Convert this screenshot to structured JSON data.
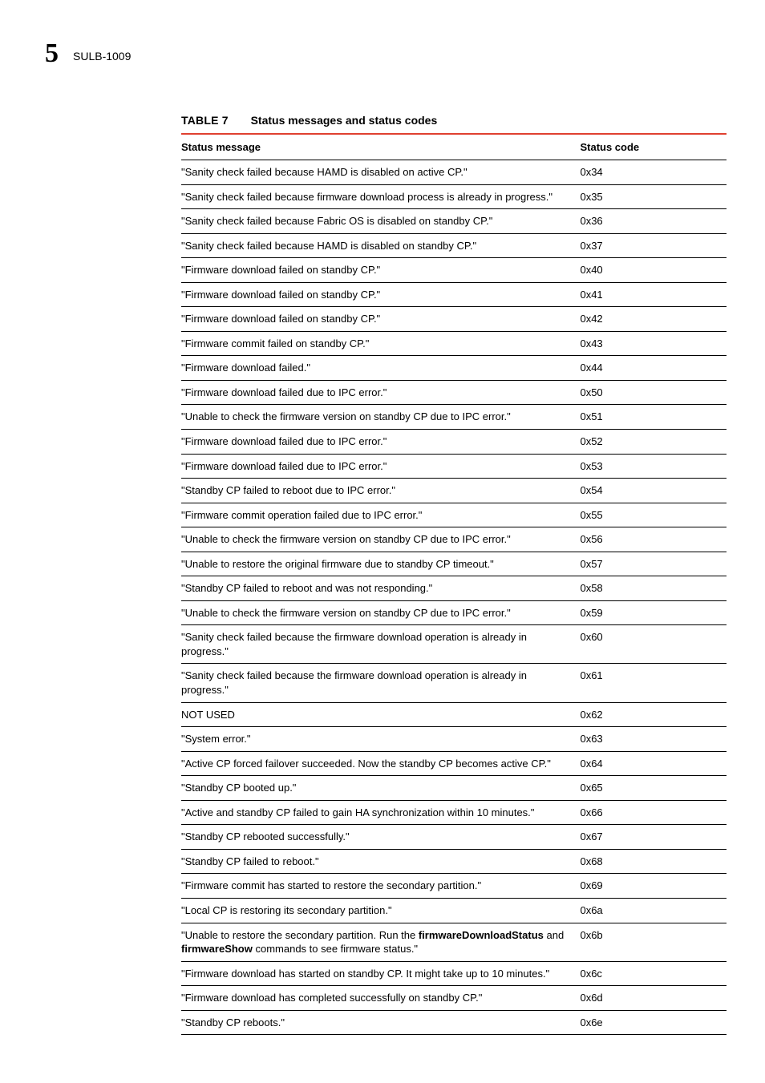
{
  "header": {
    "chapter_number": "5",
    "code": "SULB-1009"
  },
  "table": {
    "label": "TABLE 7",
    "title": "Status messages and status codes",
    "columns": {
      "message": "Status message",
      "code": "Status code"
    },
    "rows": [
      {
        "message": "\"Sanity check failed because HAMD is disabled on active CP.\"",
        "code": "0x34"
      },
      {
        "message": "\"Sanity check failed because firmware download process is already in progress.\"",
        "code": "0x35"
      },
      {
        "message": "\"Sanity check failed because Fabric OS is disabled on standby CP.\"",
        "code": "0x36"
      },
      {
        "message": "\"Sanity check failed because HAMD is disabled on standby CP.\"",
        "code": "0x37"
      },
      {
        "message": "\"Firmware download failed on standby CP.\"",
        "code": "0x40"
      },
      {
        "message": "\"Firmware download failed on standby CP.\"",
        "code": "0x41"
      },
      {
        "message": "\"Firmware download failed on standby CP.\"",
        "code": "0x42"
      },
      {
        "message": "\"Firmware commit failed on standby CP.\"",
        "code": "0x43"
      },
      {
        "message": "\"Firmware download failed.\"",
        "code": "0x44"
      },
      {
        "message": "\"Firmware download failed due to IPC error.\"",
        "code": "0x50"
      },
      {
        "message": "\"Unable to check the firmware version on standby CP due to IPC error.\"",
        "code": "0x51"
      },
      {
        "message": "\"Firmware download failed due to IPC error.\"",
        "code": "0x52"
      },
      {
        "message": "\"Firmware download failed due to IPC error.\"",
        "code": "0x53"
      },
      {
        "message": "\"Standby CP failed to reboot due to IPC error.\"",
        "code": "0x54"
      },
      {
        "message": "\"Firmware commit operation failed due to IPC error.\"",
        "code": "0x55"
      },
      {
        "message": "\"Unable to check the firmware version on standby CP due to IPC error.\"",
        "code": "0x56"
      },
      {
        "message": "\"Unable to restore the original firmware due to standby CP timeout.\"",
        "code": "0x57"
      },
      {
        "message": "\"Standby CP failed to reboot and was not responding.\"",
        "code": "0x58"
      },
      {
        "message": "\"Unable to check the firmware version on standby CP due to IPC error.\"",
        "code": "0x59"
      },
      {
        "message": "\"Sanity check failed because the firmware download operation is already in progress.\"",
        "code": "0x60"
      },
      {
        "message": "\"Sanity check failed because the firmware download operation is already in progress.\"",
        "code": "0x61"
      },
      {
        "message": "NOT USED",
        "code": "0x62"
      },
      {
        "message": "\"System error.\"",
        "code": "0x63"
      },
      {
        "message": "\"Active CP forced failover succeeded. Now the standby CP becomes active CP.\"",
        "code": "0x64"
      },
      {
        "message": "\"Standby CP booted up.\"",
        "code": "0x65"
      },
      {
        "message": "\"Active and standby CP failed to gain HA synchronization within 10 minutes.\"",
        "code": "0x66"
      },
      {
        "message": "\"Standby CP rebooted successfully.\"",
        "code": "0x67"
      },
      {
        "message": "\"Standby CP failed to reboot.\"",
        "code": "0x68"
      },
      {
        "message": "\"Firmware commit has started to restore the secondary partition.\"",
        "code": "0x69"
      },
      {
        "message": "\"Local CP is restoring its secondary partition.\"",
        "code": "0x6a"
      },
      {
        "message_parts": [
          {
            "text": "\"Unable to restore the secondary partition. Run the ",
            "bold": false
          },
          {
            "text": "firmwareDownloadStatus",
            "bold": true
          },
          {
            "text": " and ",
            "bold": false
          },
          {
            "text": "firmwareShow",
            "bold": true
          },
          {
            "text": " commands to see firmware status.\"",
            "bold": false
          }
        ],
        "code": "0x6b"
      },
      {
        "message": "\"Firmware download has started on standby CP. It might take up to 10 minutes.\"",
        "code": "0x6c"
      },
      {
        "message": "\"Firmware download has completed successfully on standby CP.\"",
        "code": "0x6d"
      },
      {
        "message": "\"Standby CP reboots.\"",
        "code": "0x6e"
      }
    ]
  }
}
